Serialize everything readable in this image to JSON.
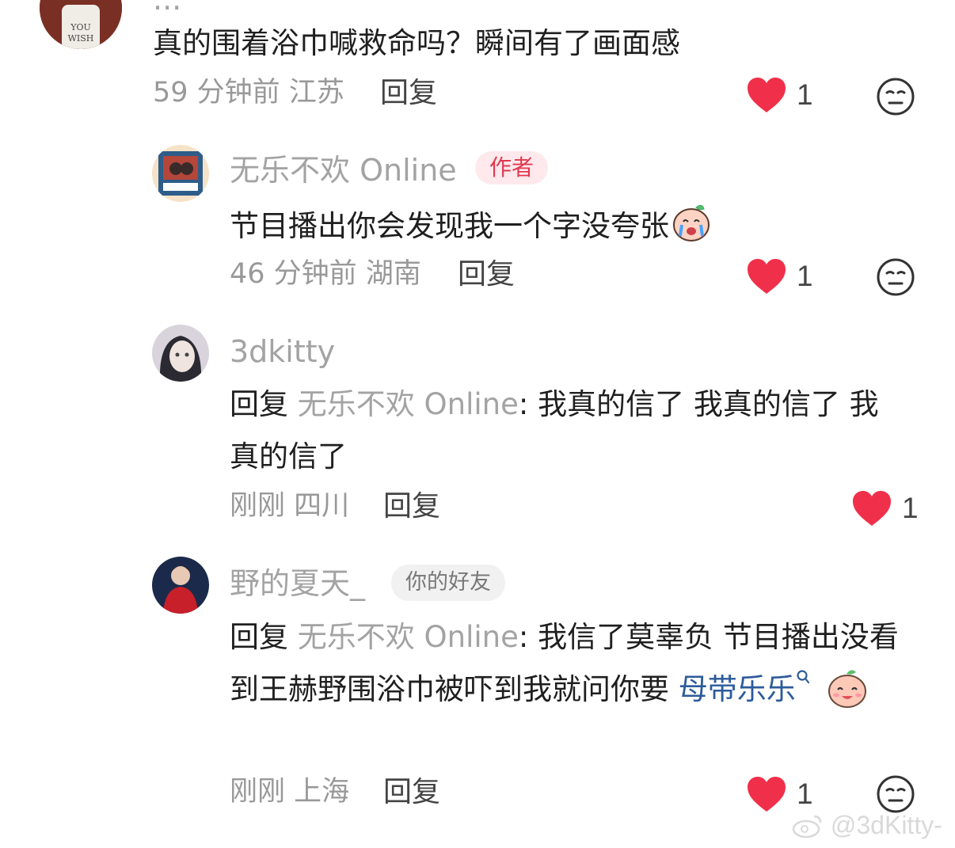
{
  "comments": [
    {
      "name_partial": "...",
      "text": "真的围着浴巾喊救命吗？瞬间有了画面感",
      "time": "59 分钟前",
      "location": "江苏",
      "reply_label": "回复",
      "likes": "1"
    },
    {
      "name": "无乐不欢 Online",
      "badge": "作者",
      "text": "节目播出你会发现我一个字没夸张",
      "time": "46 分钟前",
      "location": "湖南",
      "reply_label": "回复",
      "likes": "1"
    },
    {
      "name": "3dkitty",
      "reply_prefix": "回复",
      "reply_to": "无乐不欢 Online",
      "text": ": 我真的信了 我真的信了 我真的信了",
      "time": "刚刚",
      "location": "四川",
      "reply_label": "回复",
      "likes": "1"
    },
    {
      "name": "野的夏天_",
      "badge": "你的好友",
      "reply_prefix": "回复",
      "reply_to": "无乐不欢 Online",
      "text": ": 我信了莫辜负 节目播出没看到王赫野围浴巾被吓到我就问你要",
      "link": "母带乐乐",
      "time": "刚刚",
      "location": "上海",
      "reply_label": "回复",
      "likes": "1"
    }
  ],
  "watermark": "@3dKitty-",
  "icons": {
    "like": "heart-icon",
    "dislike": "meh-face-icon",
    "search": "search-icon",
    "sticker": "peach-sticker-icon"
  },
  "colors": {
    "heart": "#f0304a",
    "link": "#2c5b9b",
    "author_badge_bg": "#ffe9ec",
    "author_badge_text": "#e0384f"
  }
}
